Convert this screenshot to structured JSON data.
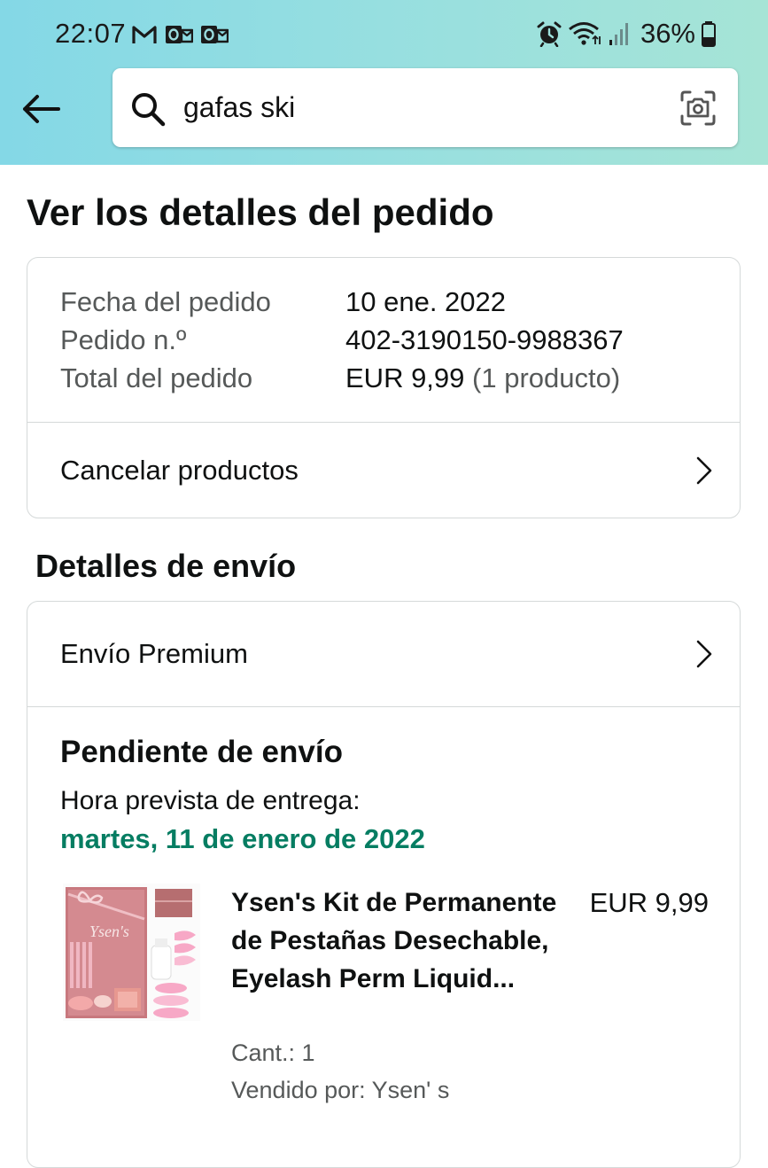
{
  "status_bar": {
    "time": "22:07",
    "left_icons": [
      "gmail-icon",
      "outlook-icon",
      "outlook-icon"
    ],
    "right_icons": [
      "alarm-icon",
      "wifi-icon",
      "signal-icon"
    ],
    "battery_percent": "36%"
  },
  "search": {
    "value": "gafas ski",
    "back_icon": "arrow-left-icon",
    "search_icon": "magnifier-icon",
    "camera_icon": "camera-scan-icon"
  },
  "colors": {
    "header_gradient_start": "#84d8e6",
    "header_gradient_end": "#a6e4d6",
    "delivery_green": "#067d62",
    "muted_text": "#565959",
    "border": "#d5d9d9"
  },
  "page": {
    "title": "Ver los detalles del pedido"
  },
  "order_summary": {
    "rows": [
      {
        "label": "Fecha del pedido",
        "value": "10 ene. 2022"
      },
      {
        "label": "Pedido n.º",
        "value": "402-3190150-9988367"
      },
      {
        "label": "Total del pedido",
        "value": "EUR 9,99",
        "extra": "(1 producto)"
      }
    ],
    "cancel_label": "Cancelar productos"
  },
  "shipping": {
    "section_title": "Detalles de envío",
    "method": "Envío Premium",
    "status": "Pendiente de envío",
    "delivery_label": "Hora prevista de entrega:",
    "delivery_date": "martes, 11 de enero de 2022"
  },
  "product": {
    "title": "Ysen's Kit de Permanente de Pestañas Desechable, Eyelash Perm Liquid...",
    "price": "EUR 9,99",
    "quantity": "Cant.: 1",
    "seller": "Vendido por: Ysen' s",
    "image_brand_text": "Ysen's",
    "image_colors": {
      "box": "#c8787e",
      "accent": "#f0b7c2",
      "pads": "#f3a9a9"
    }
  }
}
